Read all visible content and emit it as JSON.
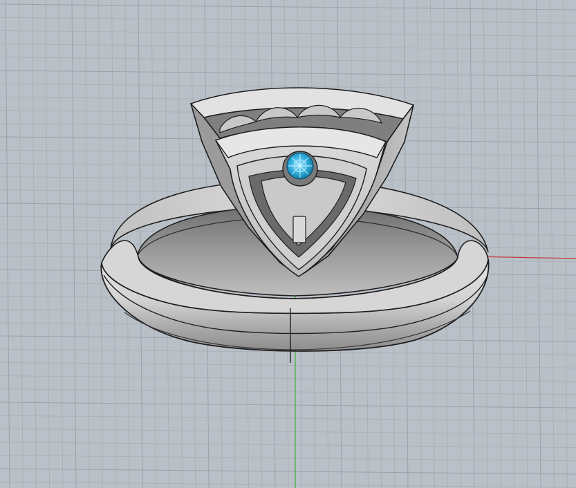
{
  "viewport": {
    "kind": "3d-perspective-viewport",
    "background_color": "#b9c0c7",
    "grid": {
      "visible": true,
      "minor_line_color": "#aab1b8",
      "major_line_color": "#9aa2aa"
    },
    "axes": {
      "x_axis_color": "#c23b3b",
      "y_axis_color": "#3fae3f"
    }
  },
  "model": {
    "object": "ring",
    "shank_material_color": "#c9c9c9",
    "outline_color": "#1e1e1e",
    "gemstone": {
      "color": "#29a8d8",
      "cut": "round"
    },
    "head_shape": "trillion-bezel"
  }
}
